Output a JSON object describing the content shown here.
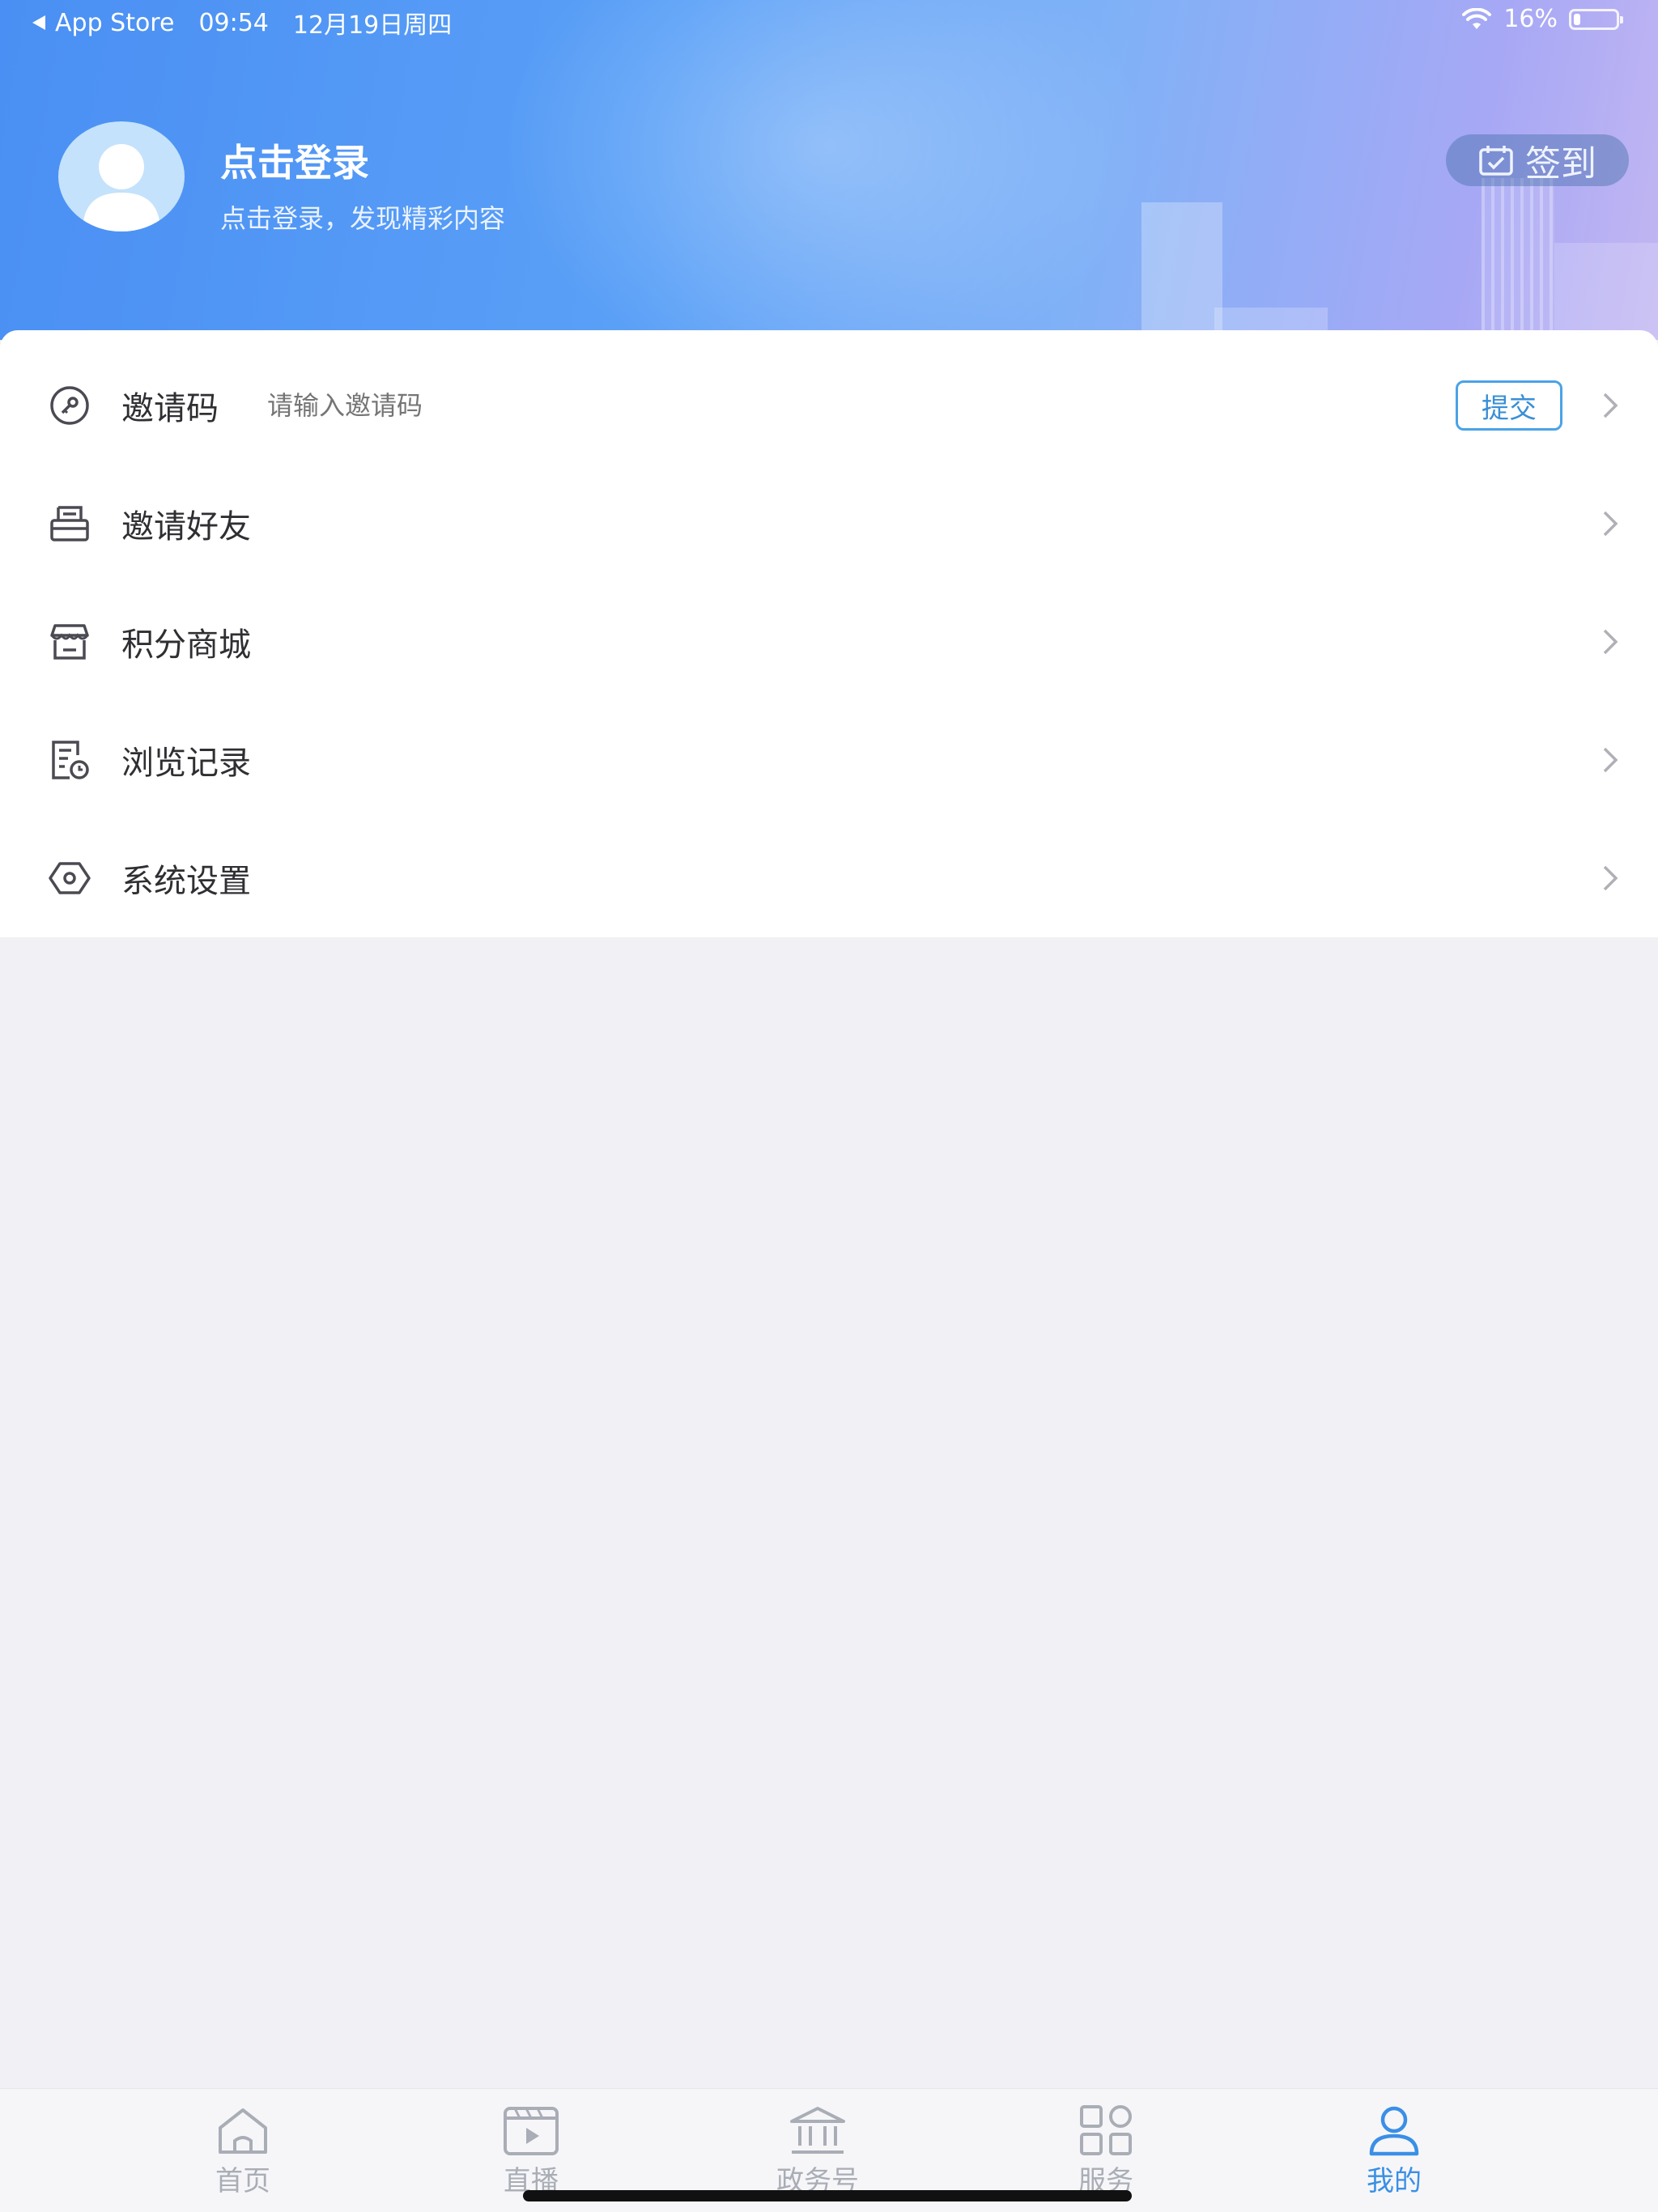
{
  "status_bar": {
    "back_app": "App Store",
    "time": "09:54",
    "date": "12月19日周四",
    "battery_percent": "16%",
    "battery_level": 0.16
  },
  "profile": {
    "title": "点击登录",
    "subtitle": "点击登录，发现精彩内容",
    "signin_label": "签到"
  },
  "menu": {
    "invite_code": {
      "label": "邀请码",
      "placeholder": "请输入邀请码",
      "submit_label": "提交"
    },
    "items": [
      {
        "label": "邀请好友",
        "icon": "invite-friend-icon"
      },
      {
        "label": "积分商城",
        "icon": "store-icon"
      },
      {
        "label": "浏览记录",
        "icon": "history-icon"
      },
      {
        "label": "系统设置",
        "icon": "settings-icon"
      }
    ]
  },
  "tabbar": {
    "tabs": [
      {
        "label": "首页",
        "icon": "home-icon"
      },
      {
        "label": "直播",
        "icon": "live-icon"
      },
      {
        "label": "政务号",
        "icon": "government-icon"
      },
      {
        "label": "服务",
        "icon": "services-icon"
      },
      {
        "label": "我的",
        "icon": "profile-icon"
      }
    ],
    "active_index": 4,
    "active_color": "#3a8fe6",
    "inactive_color": "#a9adb6"
  }
}
